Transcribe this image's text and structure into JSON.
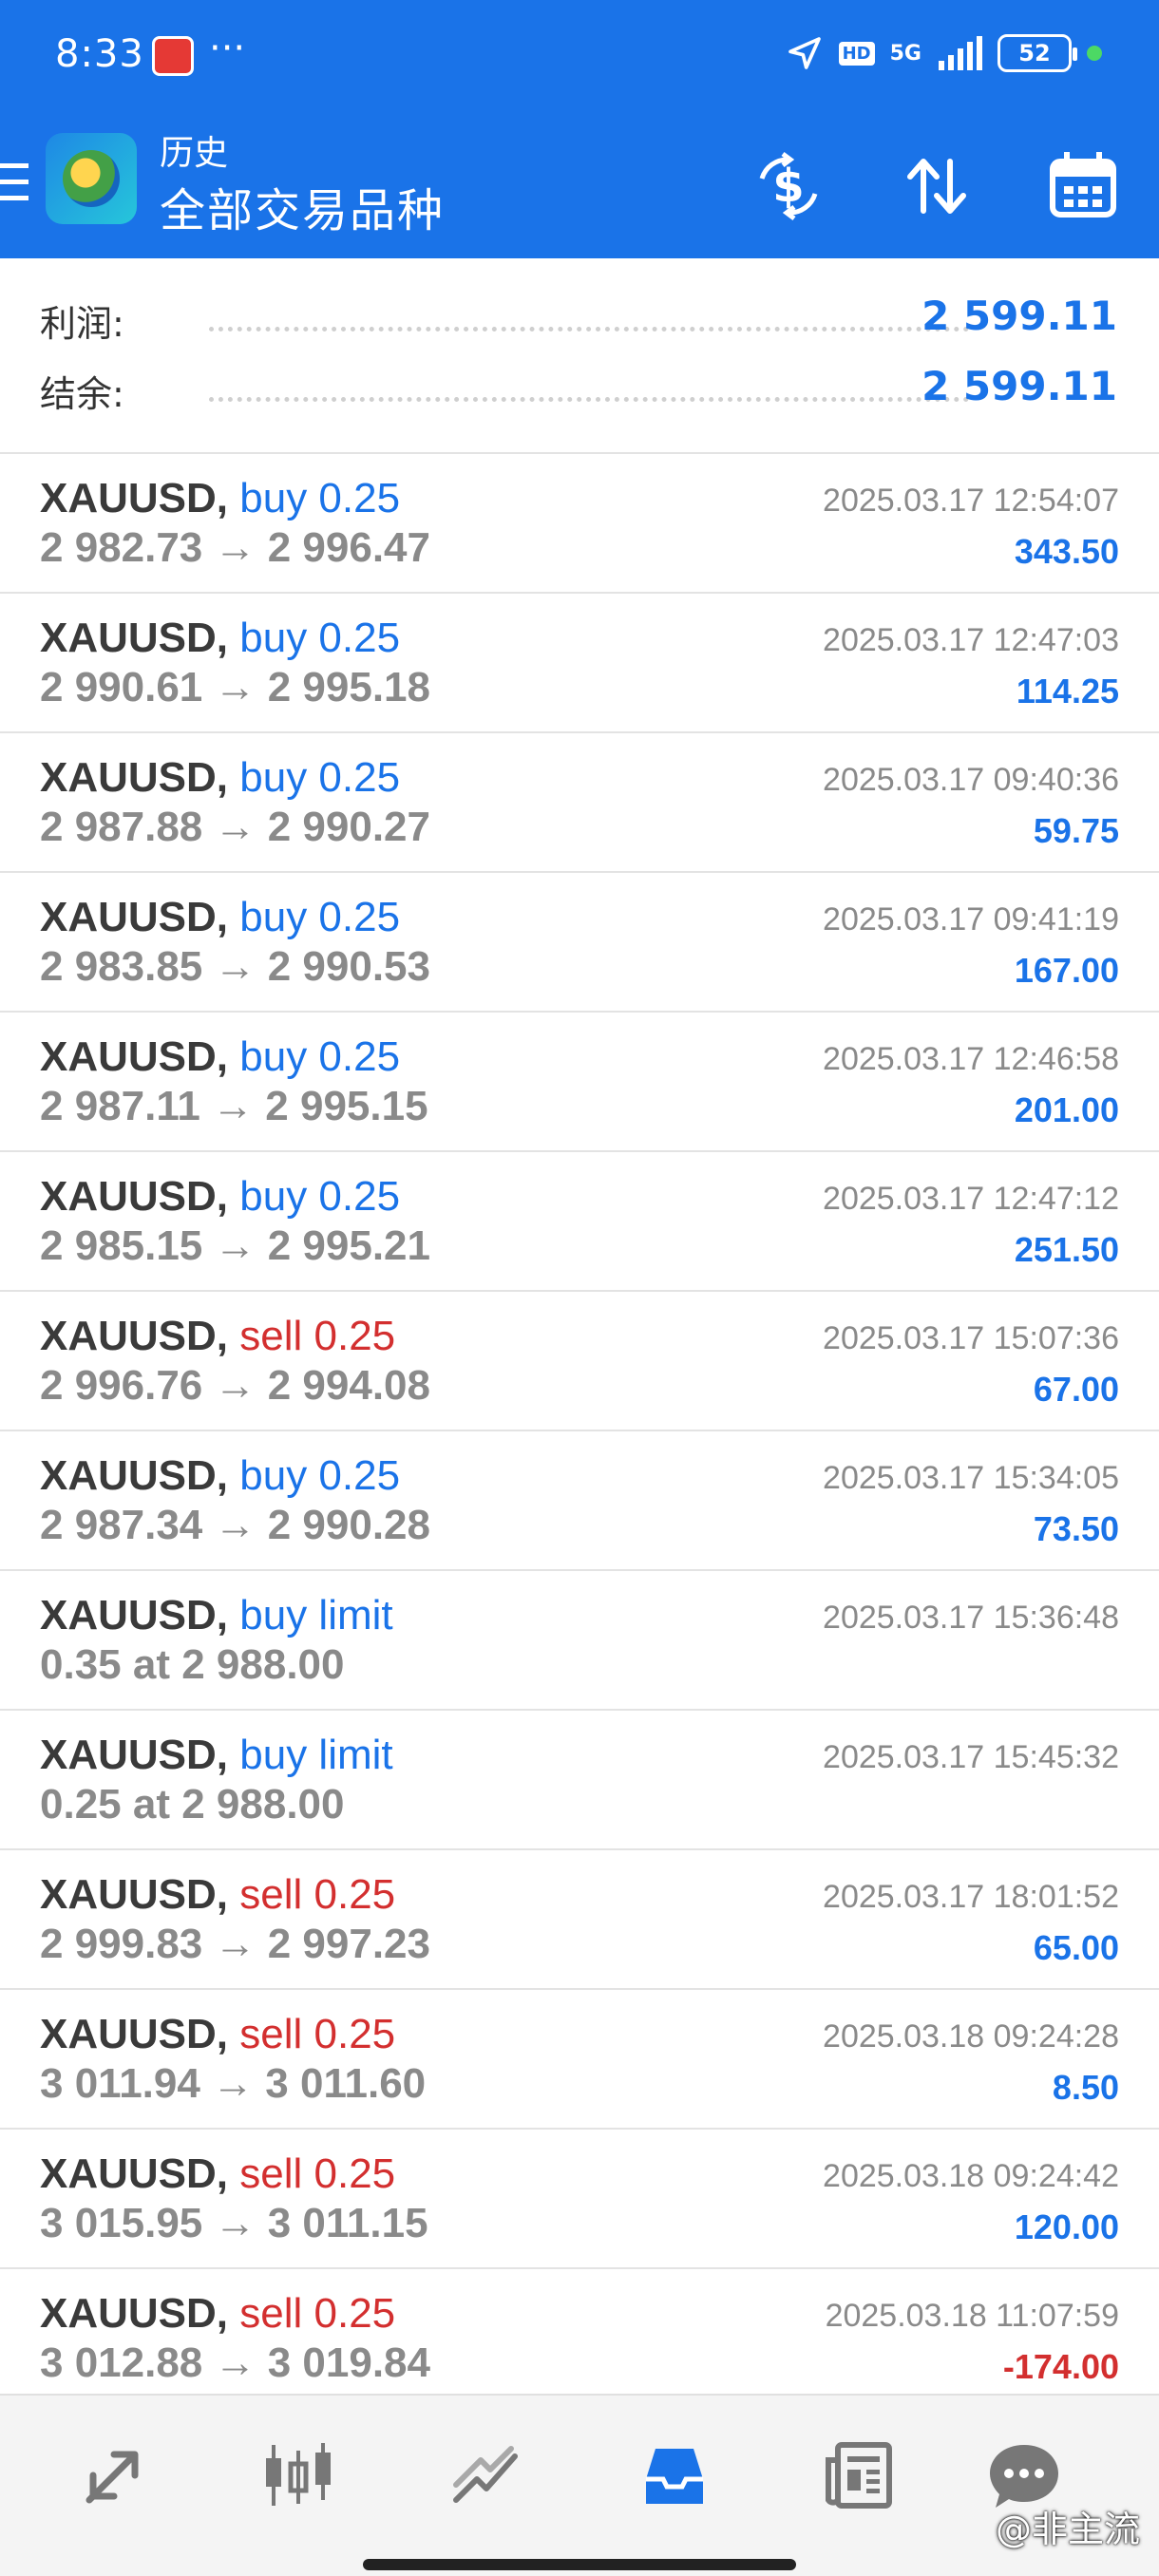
{
  "status_bar": {
    "time": "8:33",
    "more": "···",
    "network": "5G",
    "hd": "HD",
    "battery": "52"
  },
  "toolbar": {
    "title": "历史",
    "subtitle": "全部交易品种"
  },
  "summary": {
    "profit_label": "利润:",
    "profit_value": "2 599.11",
    "balance_label": "结余:",
    "balance_value": "2 599.11"
  },
  "trades": [
    {
      "symbol": "XAUUSD,",
      "type": "buy 0.25",
      "side": "buy",
      "prices": "2 982.73 → 2 996.47",
      "time": "2025.03.17 12:54:07",
      "pnl": "343.50"
    },
    {
      "symbol": "XAUUSD,",
      "type": "buy 0.25",
      "side": "buy",
      "prices": "2 990.61 → 2 995.18",
      "time": "2025.03.17 12:47:03",
      "pnl": "114.25"
    },
    {
      "symbol": "XAUUSD,",
      "type": "buy 0.25",
      "side": "buy",
      "prices": "2 987.88 → 2 990.27",
      "time": "2025.03.17 09:40:36",
      "pnl": "59.75"
    },
    {
      "symbol": "XAUUSD,",
      "type": "buy 0.25",
      "side": "buy",
      "prices": "2 983.85 → 2 990.53",
      "time": "2025.03.17 09:41:19",
      "pnl": "167.00"
    },
    {
      "symbol": "XAUUSD,",
      "type": "buy 0.25",
      "side": "buy",
      "prices": "2 987.11 → 2 995.15",
      "time": "2025.03.17 12:46:58",
      "pnl": "201.00"
    },
    {
      "symbol": "XAUUSD,",
      "type": "buy 0.25",
      "side": "buy",
      "prices": "2 985.15 → 2 995.21",
      "time": "2025.03.17 12:47:12",
      "pnl": "251.50"
    },
    {
      "symbol": "XAUUSD,",
      "type": "sell 0.25",
      "side": "sell",
      "prices": "2 996.76 → 2 994.08",
      "time": "2025.03.17 15:07:36",
      "pnl": "67.00"
    },
    {
      "symbol": "XAUUSD,",
      "type": "buy 0.25",
      "side": "buy",
      "prices": "2 987.34 → 2 990.28",
      "time": "2025.03.17 15:34:05",
      "pnl": "73.50"
    },
    {
      "symbol": "XAUUSD,",
      "type": "buy limit",
      "side": "buy",
      "prices": "0.35 at 2 988.00",
      "time": "2025.03.17 15:36:48",
      "pnl": ""
    },
    {
      "symbol": "XAUUSD,",
      "type": "buy limit",
      "side": "buy",
      "prices": "0.25 at 2 988.00",
      "time": "2025.03.17 15:45:32",
      "pnl": ""
    },
    {
      "symbol": "XAUUSD,",
      "type": "sell 0.25",
      "side": "sell",
      "prices": "2 999.83 → 2 997.23",
      "time": "2025.03.17 18:01:52",
      "pnl": "65.00"
    },
    {
      "symbol": "XAUUSD,",
      "type": "sell 0.25",
      "side": "sell",
      "prices": "3 011.94 → 3 011.60",
      "time": "2025.03.18 09:24:28",
      "pnl": "8.50"
    },
    {
      "symbol": "XAUUSD,",
      "type": "sell 0.25",
      "side": "sell",
      "prices": "3 015.95 → 3 011.15",
      "time": "2025.03.18 09:24:42",
      "pnl": "120.00"
    },
    {
      "symbol": "XAUUSD,",
      "type": "sell 0.25",
      "side": "sell",
      "prices": "3 012.88 → 3 019.84",
      "time": "2025.03.18 11:07:59",
      "pnl": "-174.00"
    }
  ],
  "bottom_nav": {
    "icons": [
      "quotes-icon",
      "chart-icon",
      "trade-icon",
      "history-icon",
      "news-icon",
      "messages-icon"
    ],
    "active": "history-icon"
  },
  "watermark": "@非主流",
  "colors": {
    "header_blue": "#1a73e8",
    "profit_blue": "#1a73e8",
    "loss_red": "#d32f2f",
    "muted_gray": "#8a8a8a"
  }
}
